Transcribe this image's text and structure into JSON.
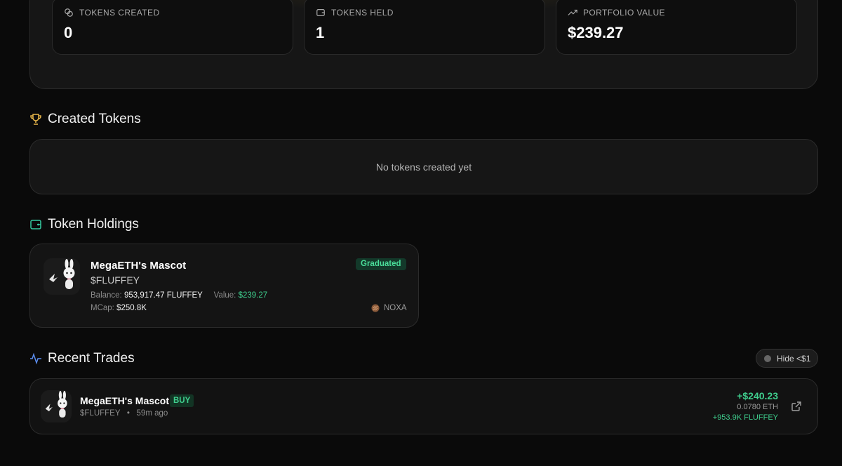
{
  "stats": {
    "tokens_created": {
      "label": "TOKENS CREATED",
      "value": "0",
      "icon": "coins-icon"
    },
    "tokens_held": {
      "label": "TOKENS HELD",
      "value": "1",
      "icon": "wallet-icon"
    },
    "portfolio_value": {
      "label": "PORTFOLIO VALUE",
      "value": "$239.27",
      "icon": "trending-up-icon"
    }
  },
  "created_tokens": {
    "title": "Created Tokens",
    "icon": "trophy-icon",
    "empty_text": "No tokens created yet"
  },
  "holdings": {
    "title": "Token Holdings",
    "icon": "wallet-icon",
    "items": [
      {
        "name": "MegaETH's Mascot",
        "ticker": "$FLUFFEY",
        "status": "Graduated",
        "balance_label": "Balance:",
        "balance": "953,917.47 FLUFFEY",
        "value_label": "Value:",
        "value": "$239.27",
        "mcap_label": "MCap:",
        "mcap": "$250.8K",
        "platform": "NOXA"
      }
    ]
  },
  "recent_trades": {
    "title": "Recent Trades",
    "icon": "activity-icon",
    "hide_toggle_label": "Hide <$1",
    "items": [
      {
        "name": "MegaETH's Mascot",
        "side": "BUY",
        "ticker": "$FLUFFEY",
        "separator": "•",
        "time": "59m ago",
        "usd": "+$240.23",
        "eth": "0.0780 ETH",
        "tokens": "+953.9K FLUFFEY"
      }
    ]
  },
  "colors": {
    "accent_green": "#3fcf8e",
    "gold": "#e8b64a",
    "teal": "#35c9a0",
    "blue": "#5b8def"
  }
}
